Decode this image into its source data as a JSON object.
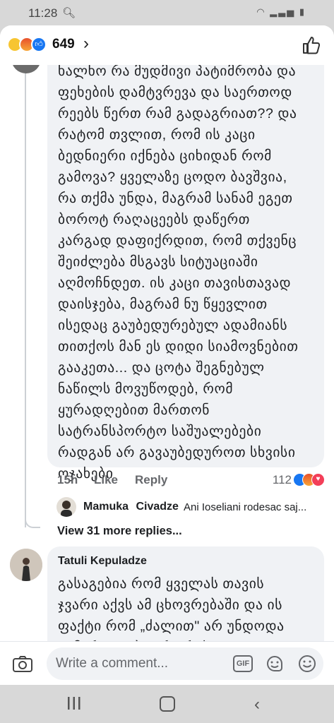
{
  "status_bar": {
    "time": "11:28"
  },
  "reactions_header": {
    "count": "649"
  },
  "comment1": {
    "lines": [
      "ხალხო რა მუდმივი პატიმრობა და",
      "ფეხების დამტვრევა და  საერთოდ",
      "რეებს წერთ რამ გადაგრიათ?? და",
      "რატომ თვლით, რომ ის კაცი",
      "ბედნიერი იქნება ციხიდან რომ",
      "გამოვა? ყველაზე ცოდო ბავშვია,",
      "რა თქმა უნდა, მაგრამ სანამ ეგეთ",
      "ბოროტ რაღაცეებს დაწერთ",
      "კარგად დაფიქრდით, რომ თქვენც",
      "შეიძლება მსგავს სიტუაციაში",
      "აღმოჩნდეთ. ის კაცი თავისთავად",
      "დაისჯება, მაგრამ ნუ წყევლით",
      "ისედაც გაუბედურებულ ადამიანს",
      "თითქოს მან ეს დიდი სიამოვნებით",
      "გააკეთა... და ცოტა შეგნებულ",
      "ნაწილს მოვუწოდებ, რომ",
      "ყურადღებით მართონ",
      "სატრანსპორტო საშუალებები",
      "რადგან არ გავაუბედუროთ სხვისი",
      "ოჯახები"
    ],
    "time": "15h",
    "like_label": "Like",
    "reply_label": "Reply",
    "reaction_count": "112"
  },
  "reply_preview": {
    "name": "Mamuka Civadze",
    "snippet": "Ani Ioseliani rodesac saj..."
  },
  "view_more_label": "View 31 more replies...",
  "comment2": {
    "name": "Tatuli Kepuladze",
    "lines": [
      "გასაგებია რომ ყველას თავის",
      "ჯვარი აქვს ამ ცხოვრებაში და ის",
      "ფაქტი რომ „ძალით\" არ უნდოდა",
      "გამართლება არ არის!!!"
    ]
  },
  "composer": {
    "placeholder": "Write a comment...",
    "gif_label": "GIF"
  },
  "colors": {
    "accent": "#1877f2",
    "bubble": "#f0f2f5",
    "secondary_text": "#65676b"
  }
}
